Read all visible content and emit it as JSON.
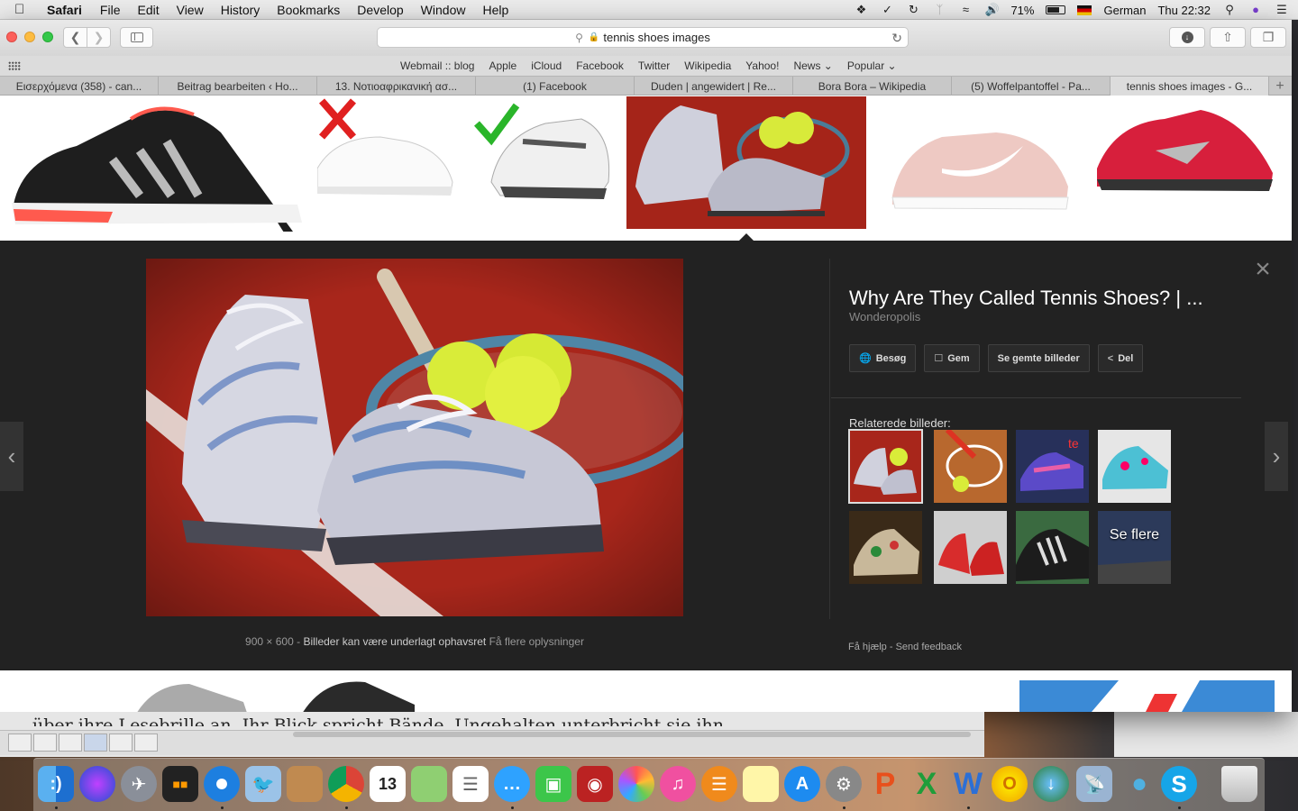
{
  "menubar": {
    "app": "Safari",
    "items": [
      "File",
      "Edit",
      "View",
      "History",
      "Bookmarks",
      "Develop",
      "Window",
      "Help"
    ],
    "battery": "71%",
    "input_source": "German",
    "clock": "Thu 22:32"
  },
  "toolbar": {
    "address": "tennis shoes images"
  },
  "favorites": [
    "Webmail :: blog",
    "Apple",
    "iCloud",
    "Facebook",
    "Twitter",
    "Wikipedia",
    "Yahoo!",
    "News ⌄",
    "Popular ⌄"
  ],
  "tabs": [
    "Εισερχόμενα (358) - can...",
    "Beitrag bearbeiten ‹ Ho...",
    "13. Νοτιοαφρικανική ασ...",
    "(1) Facebook",
    "Duden | angewidert | Re...",
    "Bora Bora – Wikipedia",
    "(5) Woffelpantoffel - Pa...",
    "tennis shoes images - G..."
  ],
  "viewer": {
    "title": "Why Are They Called Tennis Shoes? | ...",
    "source": "Wonderopolis",
    "actions": {
      "visit": "Besøg",
      "save": "Gem",
      "saved": "Se gemte billeder",
      "share": "Del"
    },
    "related_label": "Relaterede billeder:",
    "see_more": "Se flere",
    "dimensions": "900 × 600",
    "sep": "-",
    "copyright": "Billeder kan være underlagt ophavsret",
    "more_info": "Få flere oplysninger",
    "help": "Få hjælp",
    "feedback": "Send feedback"
  },
  "background_doc": {
    "text": "über ihre Lesebrille an. Ihr Blick spricht Bände. Ungehalten unterbricht sie ihn"
  },
  "colors": {
    "panel": "#222222",
    "court_red": "#a52419"
  }
}
